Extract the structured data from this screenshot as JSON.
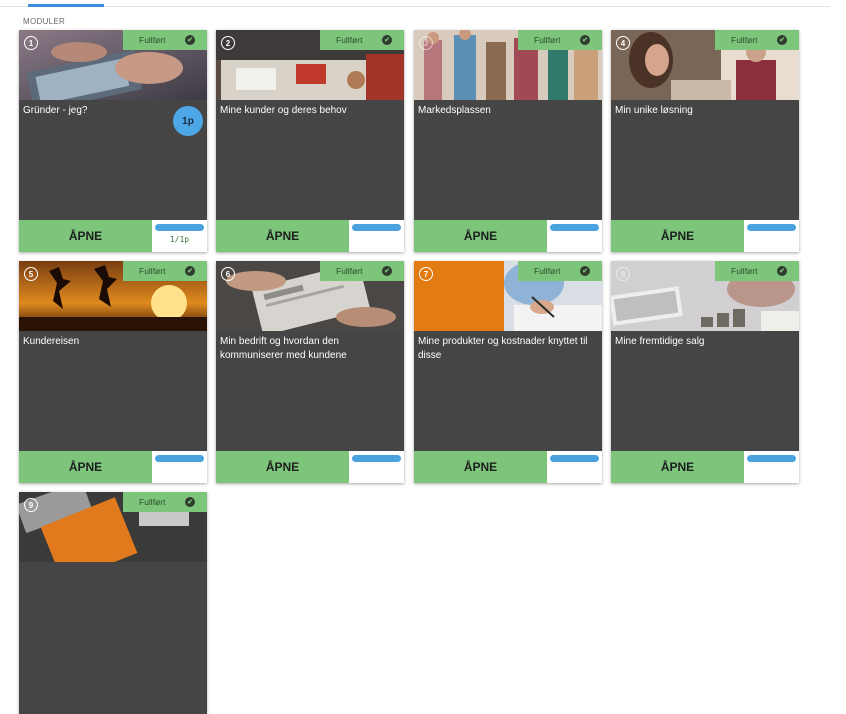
{
  "section_label": "MODULER",
  "completed_label": "Fullført",
  "open_label": "ÅPNE",
  "check_glyph": "✔",
  "colors": {
    "card_bg": "#454545",
    "green": "#7cc57a",
    "blue": "#4aa3df",
    "accent": "#3b8fd8"
  },
  "modules": [
    {
      "number": "1",
      "title": "Gründer - jeg?",
      "points_badge": "1p",
      "progress": "1/1p",
      "progress_fraction": 1.0,
      "icon": "laptop-hands-photo"
    },
    {
      "number": "2",
      "title": "Mine kunder og deres behov",
      "progress_fraction": 1.0,
      "icon": "meeting-table-photo"
    },
    {
      "number": "3",
      "title": "Markedsplassen",
      "progress_fraction": 1.0,
      "icon": "crowd-photo"
    },
    {
      "number": "4",
      "title": "Min unike løsning",
      "progress_fraction": 1.0,
      "icon": "shop-photo"
    },
    {
      "number": "5",
      "title": "Kundereisen",
      "progress_fraction": 1.0,
      "icon": "sunset-jump-photo"
    },
    {
      "number": "6",
      "title": "Min bedrift og hvordan den kommuniserer med kundene",
      "progress_fraction": 1.0,
      "icon": "newspaper-photo"
    },
    {
      "number": "7",
      "title": "Mine produkter og kostnader knyttet til disse",
      "progress_fraction": 1.0,
      "icon": "writing-photo"
    },
    {
      "number": "8",
      "title": "Mine fremtidige salg",
      "progress_fraction": 1.0,
      "icon": "coins-keyboard-photo"
    },
    {
      "number": "9",
      "title": "",
      "progress_fraction": 1.0,
      "icon": "desk-notebook-photo"
    }
  ]
}
